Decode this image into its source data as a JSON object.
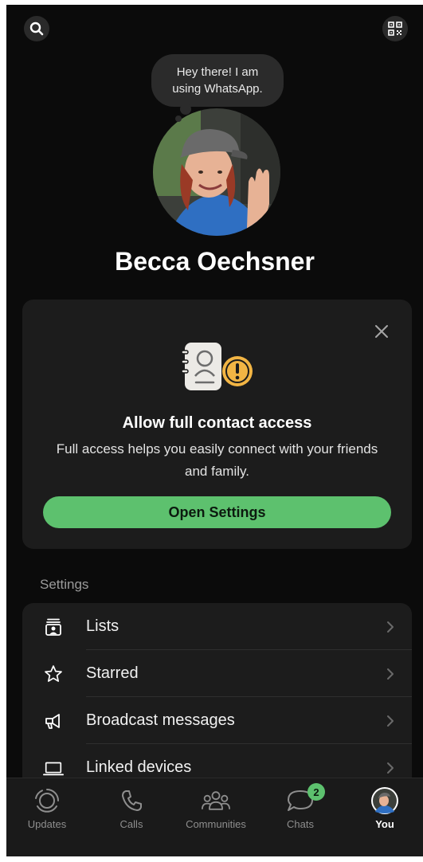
{
  "header": {
    "search_icon": "search-icon",
    "qr_icon": "qr-code-icon"
  },
  "profile": {
    "about": "Hey there! I am\nusing WhatsApp.",
    "name": "Becca Oechsner"
  },
  "contact_prompt": {
    "title": "Allow full contact access",
    "body": "Full access helps you easily connect with your friends and family.",
    "button_label": "Open Settings",
    "close_icon": "close-icon",
    "accent_color": "#5dc16e"
  },
  "settings": {
    "header": "Settings",
    "items": [
      {
        "label": "Lists",
        "icon": "lists-icon"
      },
      {
        "label": "Starred",
        "icon": "star-icon"
      },
      {
        "label": "Broadcast messages",
        "icon": "megaphone-icon"
      },
      {
        "label": "Linked devices",
        "icon": "laptop-icon"
      }
    ]
  },
  "tabbar": {
    "tabs": [
      {
        "label": "Updates",
        "icon": "updates-icon"
      },
      {
        "label": "Calls",
        "icon": "phone-icon"
      },
      {
        "label": "Communities",
        "icon": "communities-icon"
      },
      {
        "label": "Chats",
        "icon": "chat-bubble-icon",
        "badge": "2"
      },
      {
        "label": "You",
        "icon": "avatar",
        "active": true
      }
    ]
  }
}
